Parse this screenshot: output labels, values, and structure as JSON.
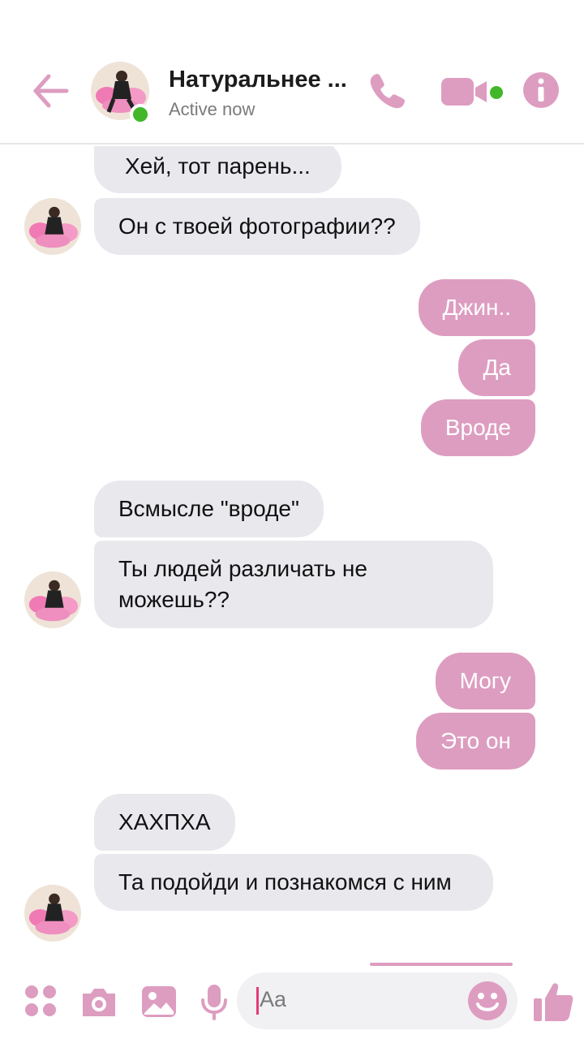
{
  "header": {
    "contact_name": "Натуральнее ...",
    "status": "Active now"
  },
  "messages": [
    {
      "side": "in",
      "text": "Хей, тот парень..."
    },
    {
      "side": "in",
      "text": "Он с твоей фотографии??"
    },
    {
      "side": "out",
      "text": "Джин.."
    },
    {
      "side": "out",
      "text": "Да"
    },
    {
      "side": "out",
      "text": "Вроде"
    },
    {
      "side": "in",
      "text": "Всмысле \"вроде\""
    },
    {
      "side": "in",
      "text": "Ты людей различать не можешь??"
    },
    {
      "side": "out",
      "text": "Могу"
    },
    {
      "side": "out",
      "text": "Это он"
    },
    {
      "side": "in",
      "text": "ХАХПХА"
    },
    {
      "side": "in",
      "text": "Та подойди и познакомся с ним"
    }
  ],
  "composer": {
    "placeholder": "Aa"
  },
  "colors": {
    "accent": "#dd9dc0",
    "online": "#42b72a",
    "incoming_bubble": "#e9e8ed"
  },
  "icons": [
    "back-arrow-icon",
    "phone-icon",
    "video-camera-icon",
    "info-icon",
    "apps-icon",
    "camera-icon",
    "image-icon",
    "microphone-icon",
    "emoji-icon",
    "thumbs-up-icon"
  ]
}
